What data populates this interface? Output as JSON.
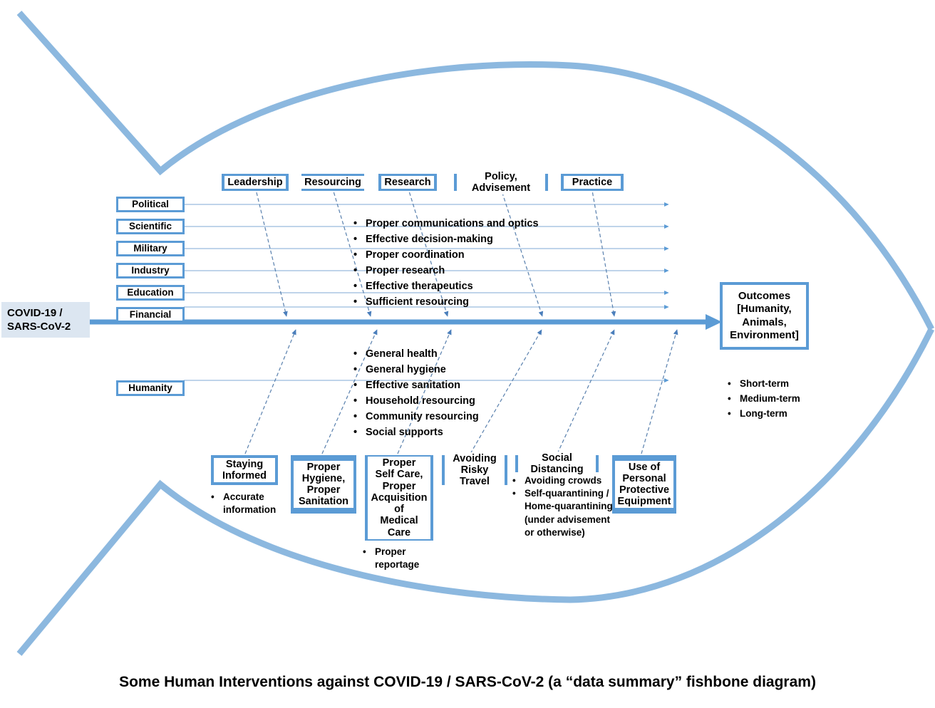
{
  "source": {
    "line1": "COVID-19 /",
    "line2": "SARS-CoV-2"
  },
  "outcomes": {
    "title": "Outcomes\n[Humanity,\nAnimals,\nEnvironment]",
    "bullets": [
      "Short-term",
      "Medium-term",
      "Long-term"
    ]
  },
  "top_categories": [
    {
      "label": "Leadership"
    },
    {
      "label": "Resourcing"
    },
    {
      "label": "Research"
    },
    {
      "label": "Policy, Advisement"
    },
    {
      "label": "Practice"
    }
  ],
  "actor_rows": [
    {
      "label": "Political"
    },
    {
      "label": "Scientific"
    },
    {
      "label": "Military"
    },
    {
      "label": "Industry"
    },
    {
      "label": "Education"
    },
    {
      "label": "Financial"
    }
  ],
  "humanity_row": {
    "label": "Humanity"
  },
  "top_bullets": [
    "Proper communications and optics",
    "Effective decision-making",
    "Proper coordination",
    "Proper research",
    "Effective therapeutics",
    "Sufficient resourcing"
  ],
  "middle_bullets": [
    "General health",
    "General hygiene",
    "Effective sanitation",
    "Household resourcing",
    "Community resourcing",
    "Social supports"
  ],
  "bottom_categories": [
    {
      "label": "Staying\nInformed",
      "bullets": [
        "Accurate information"
      ]
    },
    {
      "label": "Proper\nHygiene,\nProper\nSanitation",
      "bullets": []
    },
    {
      "label": "Proper\nSelf Care,\nProper\nAcquisition\nof\nMedical Care",
      "bullets": [
        "Proper reportage"
      ]
    },
    {
      "label": "Avoiding\nRisky Travel",
      "bullets": []
    },
    {
      "label": "Social Distancing",
      "bullets": [
        "Avoiding crowds",
        "Self-quarantining  / Home-quarantining (under advisement or otherwise)"
      ]
    },
    {
      "label": "Use of\nPersonal\nProtective\nEquipment",
      "bullets": []
    }
  ],
  "caption": "Some Human Interventions against COVID-19 / SARS-CoV-2 (a “data summary” fishbone diagram)",
  "colors": {
    "accent": "#5B9BD5",
    "fish_outline": "#8CB8DF",
    "source_bg": "#DCE6F1",
    "bone_line": "#4A7EBB",
    "rib_line": "#7FA9D4"
  }
}
